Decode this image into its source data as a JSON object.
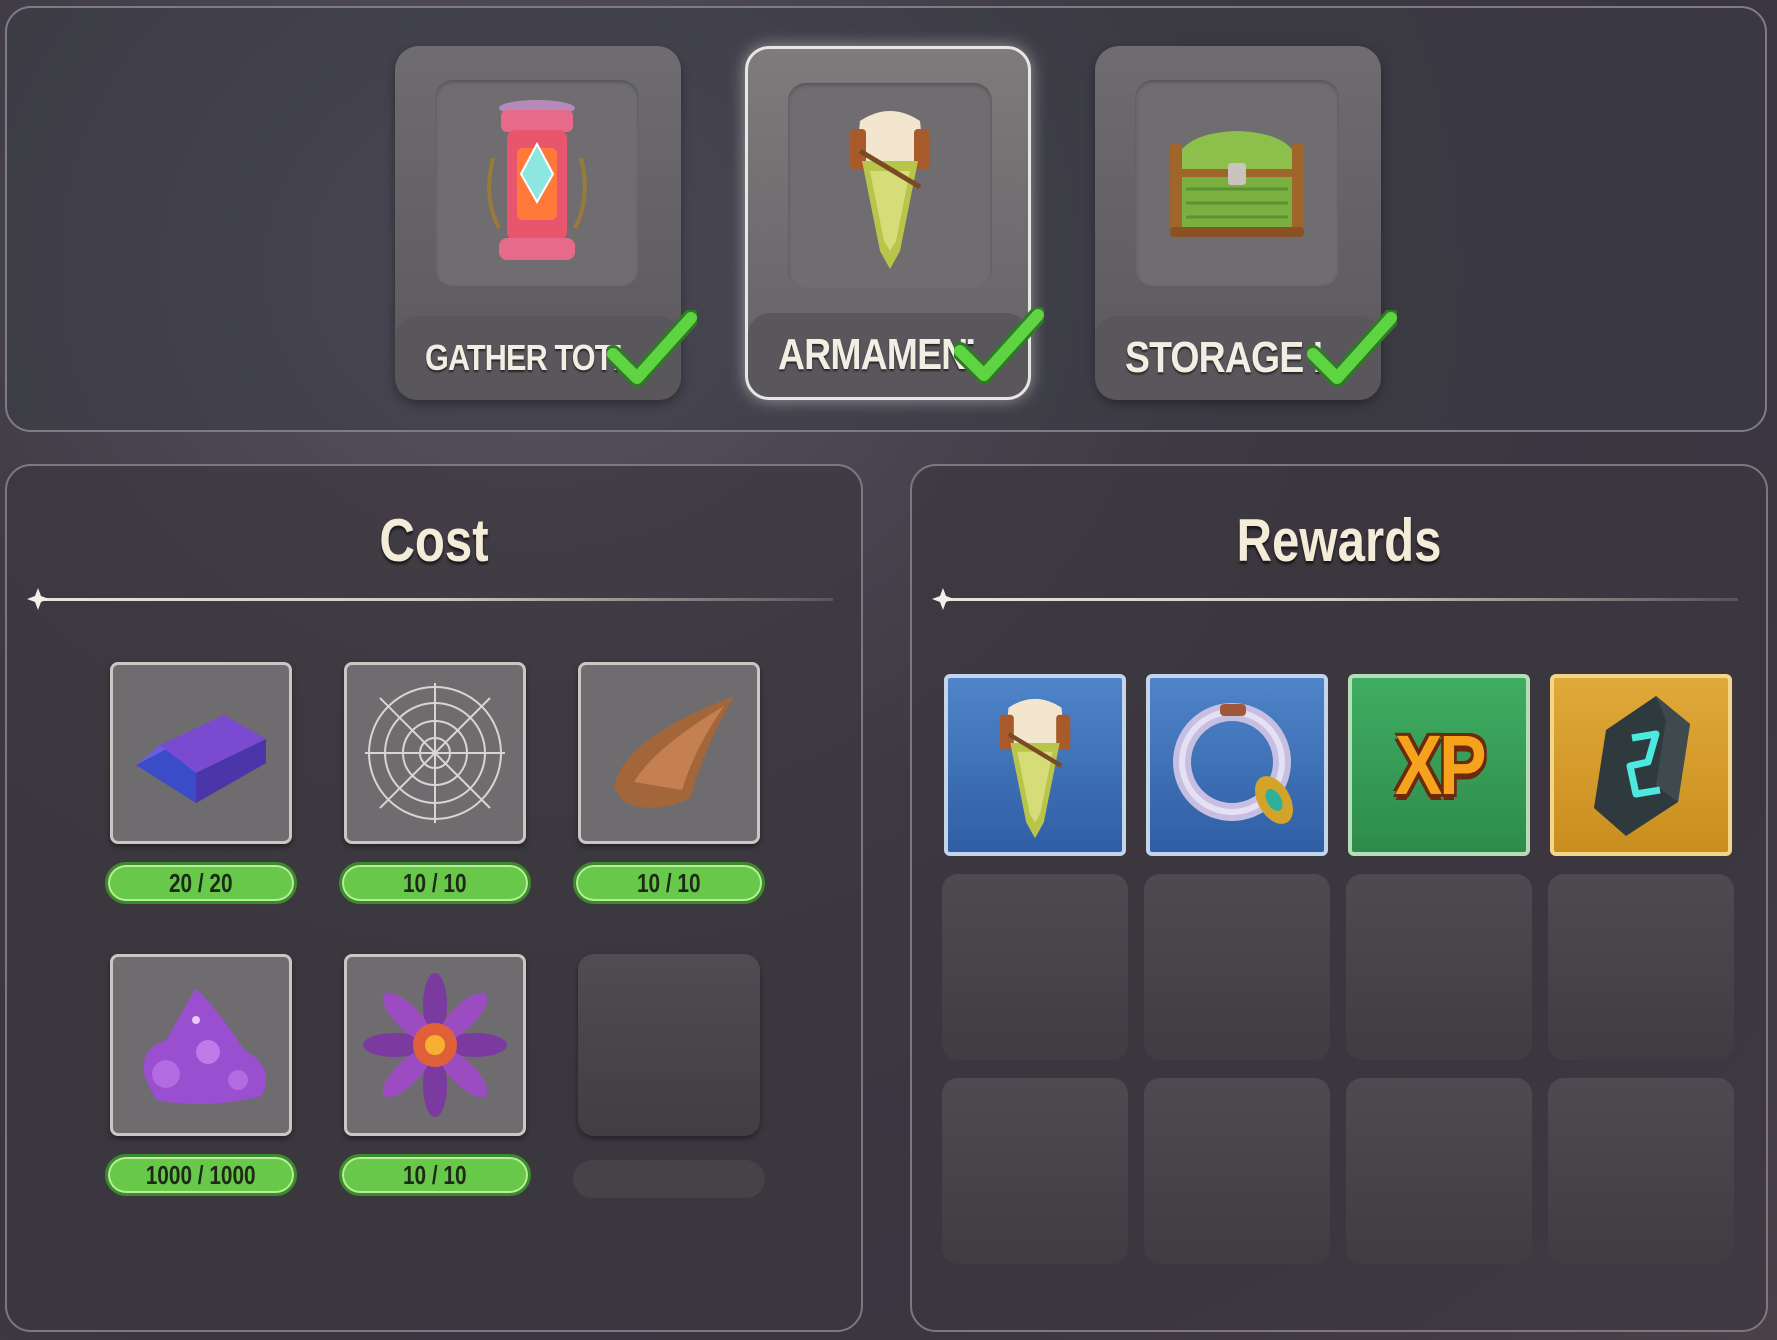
{
  "buildings": [
    {
      "label": "GATHER TOTEM II",
      "icon": "gather-totem-icon",
      "completed": true,
      "selected": false
    },
    {
      "label": "ARMAMENT II",
      "icon": "armament-icon",
      "completed": true,
      "selected": true
    },
    {
      "label": "STORAGE II",
      "icon": "storage-chest-icon",
      "completed": true,
      "selected": false
    }
  ],
  "cost": {
    "title": "Cost",
    "items": [
      {
        "icon": "metal-ingot-icon",
        "count": "20 / 20"
      },
      {
        "icon": "spider-web-icon",
        "count": "10 / 10"
      },
      {
        "icon": "horn-icon",
        "count": "10 / 10"
      },
      {
        "icon": "purple-crystal-ore-icon",
        "count": "1000 / 1000"
      },
      {
        "icon": "purple-flower-icon",
        "count": "10 / 10"
      }
    ]
  },
  "rewards": {
    "title": "Rewards",
    "items": [
      {
        "icon": "armament-icon",
        "rarity": "blue"
      },
      {
        "icon": "ring-icon",
        "rarity": "blue"
      },
      {
        "icon": "xp-icon",
        "label": "XP",
        "rarity": "green"
      },
      {
        "icon": "rune-stone-icon",
        "rarity": "gold"
      }
    ]
  },
  "colors": {
    "progress_complete": "#68c84a",
    "check_green": "#4fc83a",
    "title_text": "#f3ecd8"
  }
}
